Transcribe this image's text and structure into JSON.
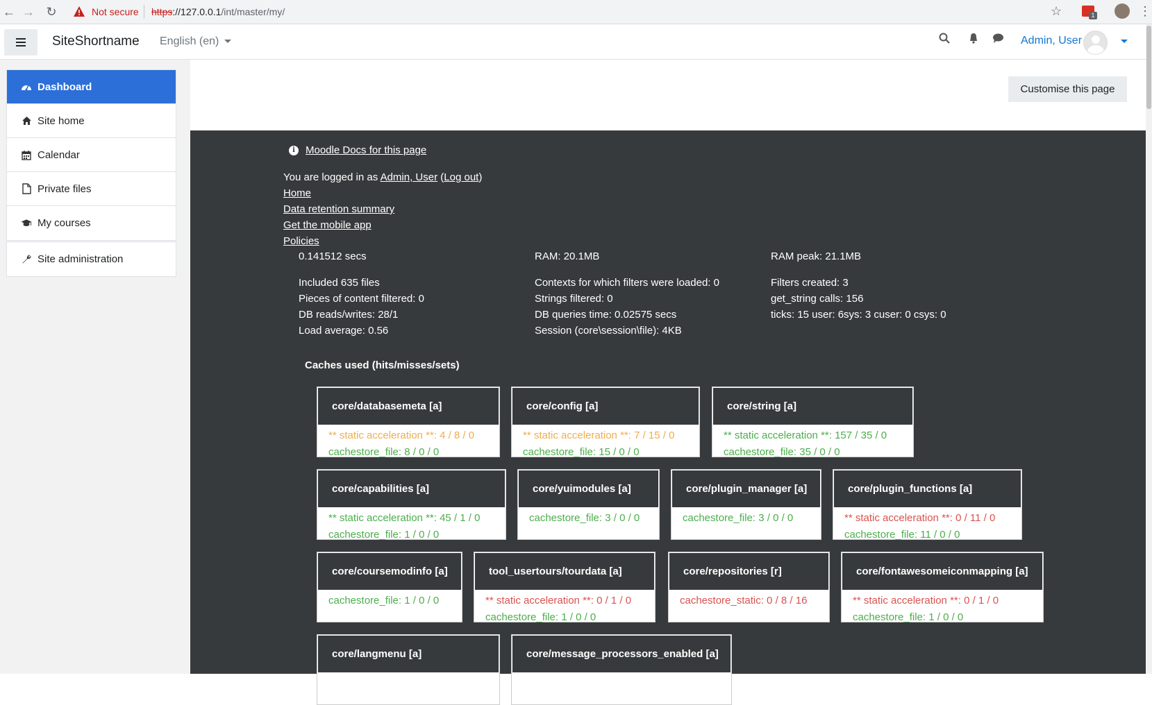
{
  "browser": {
    "security_label": "Not secure",
    "url_protocol": "https",
    "url_host": "://127.0.0.1",
    "url_path": "/int/master/my/",
    "extension_badge": "1"
  },
  "navbar": {
    "site_name": "SiteShortname",
    "language": "English (en)",
    "user_name": "Admin, User"
  },
  "sidebar": {
    "items": [
      {
        "label": "Dashboard",
        "icon": "dashboard-icon"
      },
      {
        "label": "Site home",
        "icon": "home-icon"
      },
      {
        "label": "Calendar",
        "icon": "calendar-icon"
      },
      {
        "label": "Private files",
        "icon": "file-icon"
      },
      {
        "label": "My courses",
        "icon": "graduation-cap-icon"
      }
    ],
    "admin_item": {
      "label": "Site administration",
      "icon": "wrench-icon"
    }
  },
  "main": {
    "customise_label": "Customise this page"
  },
  "footer": {
    "docs_link": "Moodle Docs for this page",
    "logged_in_prefix": "You are logged in as ",
    "logged_in_user": "Admin, User",
    "logout_open": " (",
    "logout_label": "Log out",
    "logout_close": ")",
    "links": [
      "Home",
      "Data retention summary",
      "Get the mobile app",
      "Policies"
    ],
    "perf": {
      "time": "0.141512 secs",
      "ram": "RAM: 20.1MB",
      "ram_peak": "RAM peak: 21.1MB",
      "included": "Included 635 files",
      "contexts": "Contexts for which filters were loaded: 0",
      "filters_created": "Filters created: 3",
      "pieces": "Pieces of content filtered: 0",
      "strings": "Strings filtered: 0",
      "get_string": "get_string calls: 156",
      "db_rw": "DB reads/writes: 28/1",
      "db_time": "DB queries time: 0.02575 secs",
      "ticks": "ticks: 15 user: 6sys: 3 cuser: 0 csys: 0",
      "load": "Load average: 0.56",
      "session": "Session (core\\session\\file): 4KB"
    },
    "caches_title": "Caches used (hits/misses/sets)",
    "caches": [
      {
        "name": "core/databasemeta [a]",
        "lines": [
          {
            "text": "** static acceleration **: 4 / 8 / 0",
            "color": "#f0ad4e"
          },
          {
            "text": "cachestore_file: 8 / 0 / 0",
            "color": "#4cae4c"
          }
        ]
      },
      {
        "name": "core/config [a]",
        "lines": [
          {
            "text": "** static acceleration **: 7 / 15 / 0",
            "color": "#f0ad4e"
          },
          {
            "text": "cachestore_file: 15 / 0 / 0",
            "color": "#4cae4c"
          }
        ]
      },
      {
        "name": "core/string [a]",
        "lines": [
          {
            "text": "** static acceleration **: 157 / 35 / 0",
            "color": "#4cae4c"
          },
          {
            "text": "cachestore_file: 35 / 0 / 0",
            "color": "#4cae4c"
          }
        ]
      },
      {
        "name": "core/capabilities [a]",
        "lines": [
          {
            "text": "** static acceleration **: 45 / 1 / 0",
            "color": "#4cae4c"
          },
          {
            "text": "cachestore_file: 1 / 0 / 0",
            "color": "#4cae4c"
          }
        ]
      },
      {
        "name": "core/yuimodules [a]",
        "lines": [
          {
            "text": "cachestore_file: 3 / 0 / 0",
            "color": "#4cae4c"
          }
        ]
      },
      {
        "name": "core/plugin_manager [a]",
        "lines": [
          {
            "text": "cachestore_file: 3 / 0 / 0",
            "color": "#4cae4c"
          }
        ]
      },
      {
        "name": "core/plugin_functions [a]",
        "lines": [
          {
            "text": "** static acceleration **: 0 / 11 / 0",
            "color": "#d9534f"
          },
          {
            "text": "cachestore_file: 11 / 0 / 0",
            "color": "#4cae4c"
          }
        ]
      },
      {
        "name": "core/coursemodinfo [a]",
        "lines": [
          {
            "text": "cachestore_file: 1 / 0 / 0",
            "color": "#4cae4c"
          }
        ]
      },
      {
        "name": "tool_usertours/tourdata [a]",
        "lines": [
          {
            "text": "** static acceleration **: 0 / 1 / 0",
            "color": "#d9534f"
          },
          {
            "text": "cachestore_file: 1 / 0 / 0",
            "color": "#4cae4c"
          }
        ]
      },
      {
        "name": "core/repositories [r]",
        "lines": [
          {
            "text": "cachestore_static: 0 / 8 / 16",
            "color": "#d9534f"
          }
        ]
      },
      {
        "name": "core/fontawesomeiconmapping [a]",
        "lines": [
          {
            "text": "** static acceleration **: 0 / 1 / 0",
            "color": "#d9534f"
          },
          {
            "text": "cachestore_file: 1 / 0 / 0",
            "color": "#4cae4c"
          }
        ]
      },
      {
        "name": "core/langmenu [a]",
        "lines": []
      },
      {
        "name": "core/message_processors_enabled [a]",
        "lines": []
      }
    ]
  }
}
